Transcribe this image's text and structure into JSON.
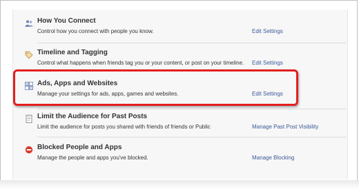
{
  "rows": [
    {
      "title": "How You Connect",
      "desc": "Control how you connect with people you know.",
      "link": "Edit Settings",
      "icon": "people-icon"
    },
    {
      "title": "Timeline and Tagging",
      "desc": "Control what happens when friends tag you or your content, or post on your timeline.",
      "link": "Edit Settings",
      "icon": "tag-icon"
    },
    {
      "title": "Ads, Apps and Websites",
      "desc": "Manage your settings for ads, apps, games and websites.",
      "link": "Edit Settings",
      "icon": "apps-icon"
    },
    {
      "title": "Limit the Audience for Past Posts",
      "desc": "Limit the audience for posts you shared with friends of friends or Public",
      "link": "Manage Past Post Visibility",
      "icon": "lock-icon"
    },
    {
      "title": "Blocked People and Apps",
      "desc": "Manage the people and apps you've blocked.",
      "link": "Manage Blocking",
      "icon": "block-icon"
    }
  ],
  "colors": {
    "link": "#3b5998",
    "highlight": "#e41e1e",
    "block_icon": "#d93a2b"
  }
}
